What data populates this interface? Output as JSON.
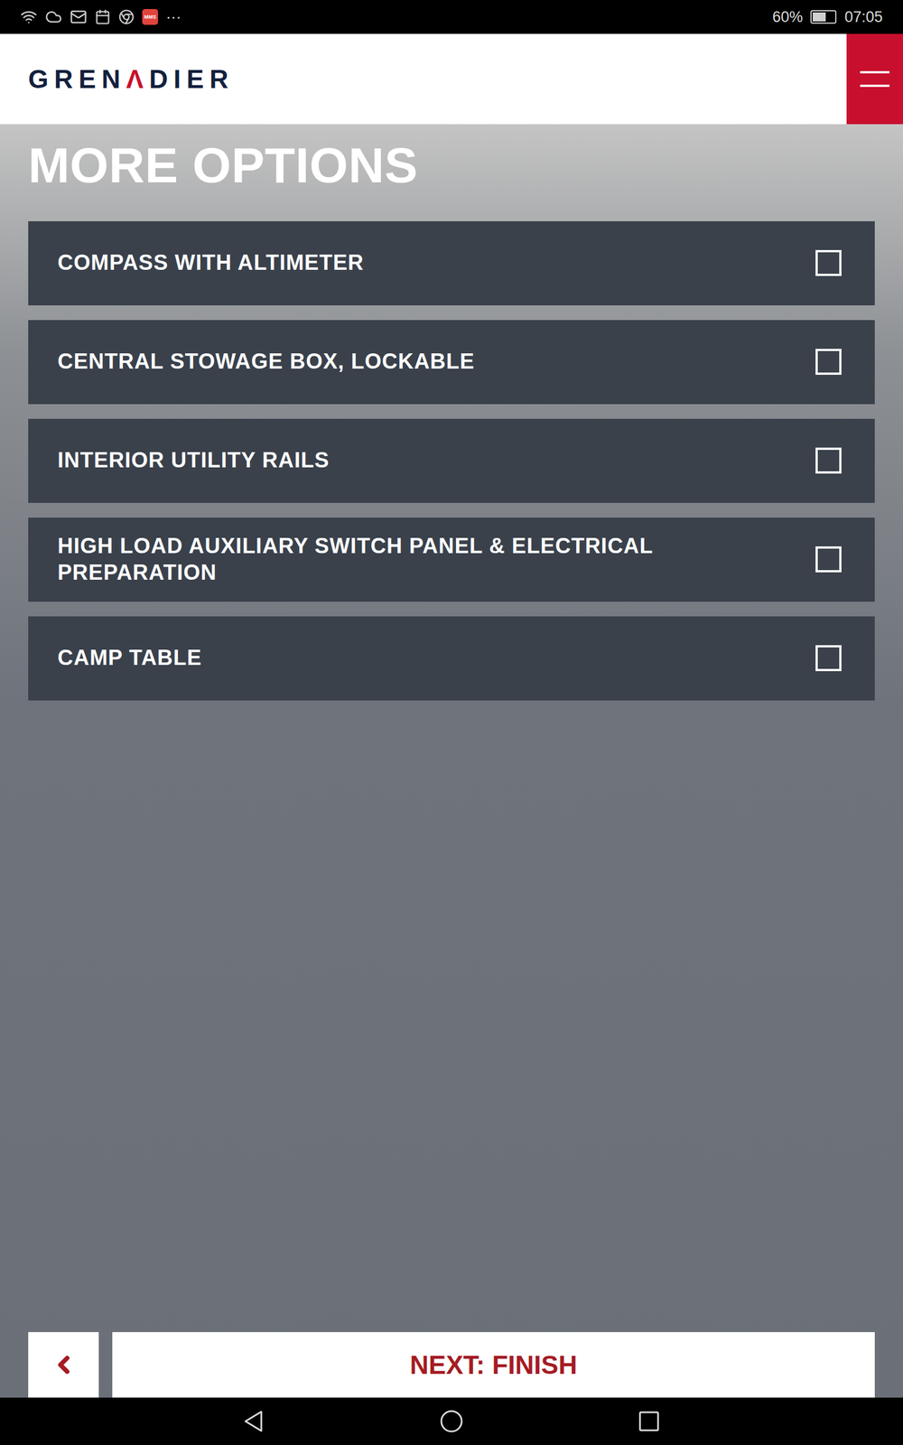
{
  "status_bar": {
    "mms_label": "MMS",
    "more": "···",
    "battery": "60%",
    "battery_level": 0.6,
    "time": "07:05"
  },
  "header": {
    "logo": [
      "GREN",
      "Λ",
      "DIER"
    ]
  },
  "title": "MORE OPTIONS",
  "options": [
    {
      "label": "COMPASS WITH ALTIMETER",
      "checked": false
    },
    {
      "label": "CENTRAL STOWAGE BOX, LOCKABLE",
      "checked": false
    },
    {
      "label": "INTERIOR UTILITY RAILS",
      "checked": false
    },
    {
      "label": "HIGH LOAD AUXILIARY SWITCH PANEL & ELECTRICAL PREPARATION",
      "checked": false
    },
    {
      "label": "CAMP TABLE",
      "checked": false
    }
  ],
  "footer": {
    "next": "NEXT: FINISH"
  }
}
